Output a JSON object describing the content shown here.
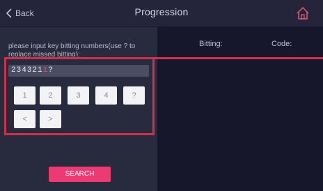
{
  "header": {
    "back_label": "Back",
    "title": "Progression"
  },
  "left": {
    "instruction": "please input key bitting numbers(use ? to replace missed bitting):",
    "input_digits": "234321",
    "input_cursor": "1",
    "input_tail": "?",
    "keypad": [
      "1",
      "2",
      "3",
      "4",
      "?"
    ],
    "nav_prev": "<",
    "nav_next": ">",
    "search_label": "SEARCH"
  },
  "right": {
    "col_bitting": "Bitting:",
    "col_code": "Code:"
  },
  "colors": {
    "accent": "#ee3a72",
    "highlight": "#d2304a",
    "home_icon": "#e65a6e"
  }
}
